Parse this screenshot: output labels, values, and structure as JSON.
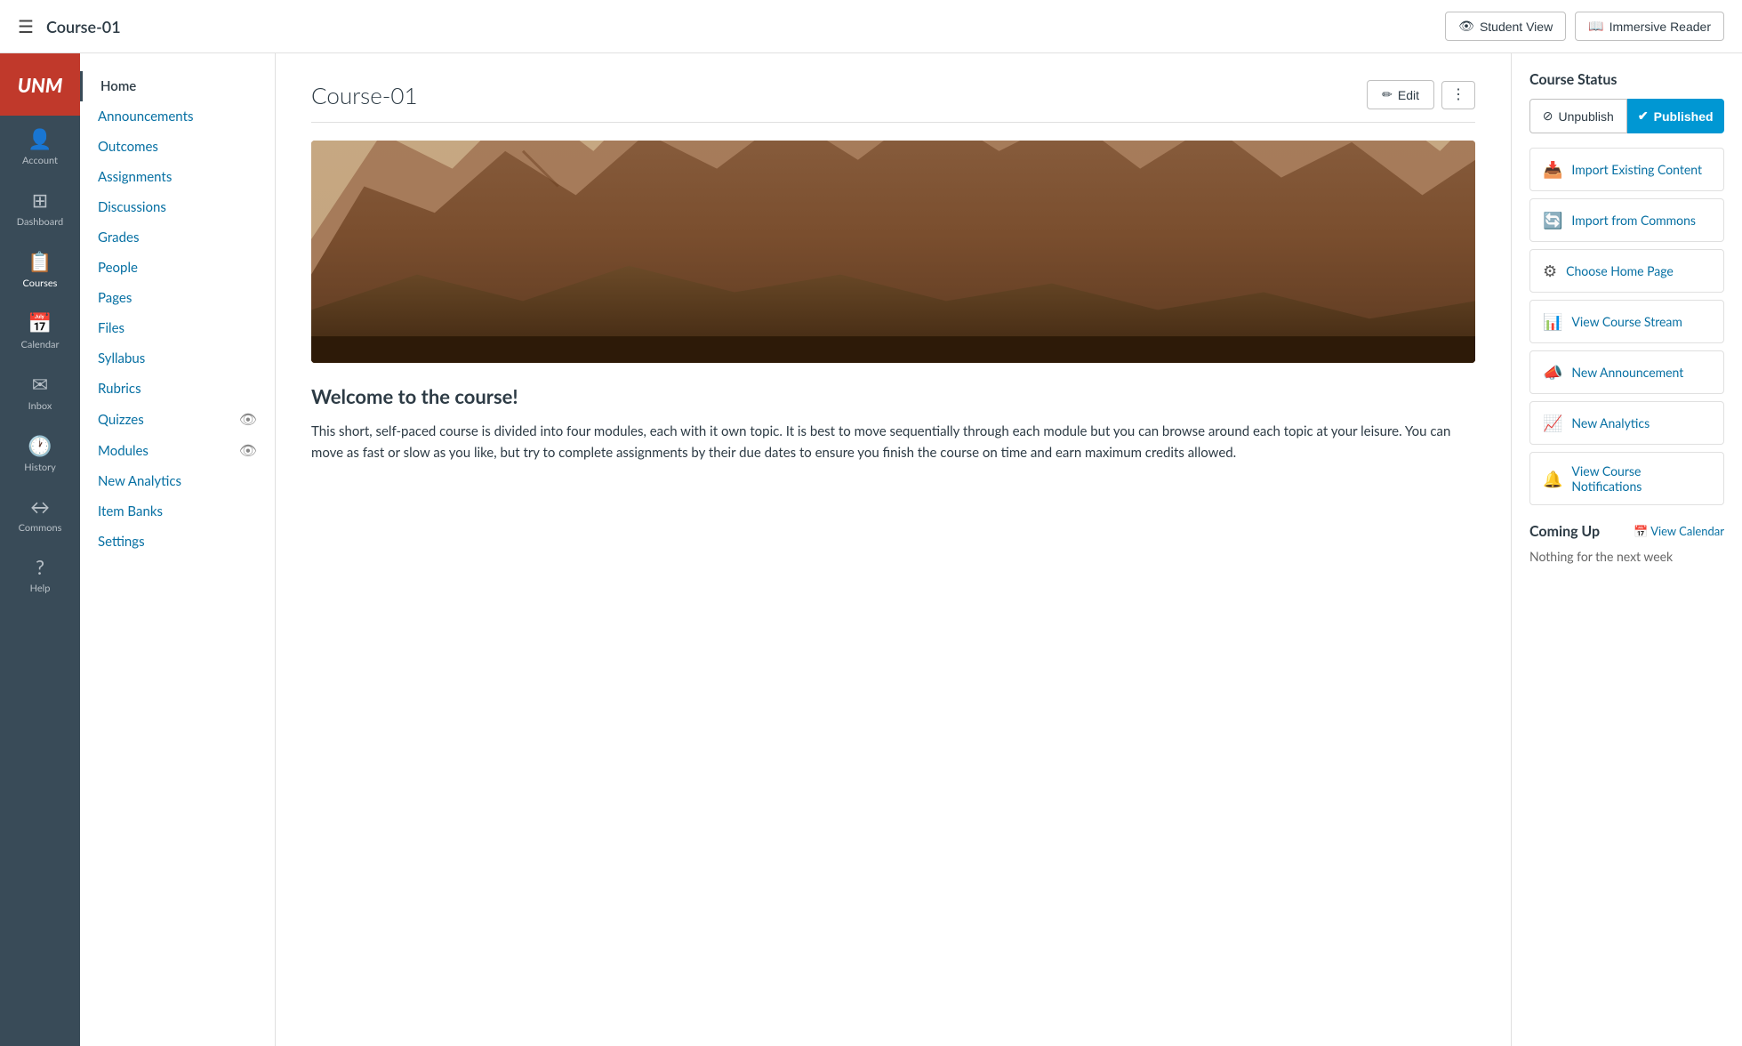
{
  "topbar": {
    "title": "Course-01",
    "hamburger_label": "☰",
    "student_view_label": "Student View",
    "immersive_reader_label": "Immersive Reader"
  },
  "global_nav": {
    "items": [
      {
        "id": "account",
        "label": "Account",
        "icon": "👤"
      },
      {
        "id": "dashboard",
        "label": "Dashboard",
        "icon": "⊞"
      },
      {
        "id": "courses",
        "label": "Courses",
        "icon": "📋"
      },
      {
        "id": "calendar",
        "label": "Calendar",
        "icon": "📅"
      },
      {
        "id": "inbox",
        "label": "Inbox",
        "icon": "✉"
      },
      {
        "id": "history",
        "label": "History",
        "icon": "🕐"
      },
      {
        "id": "commons",
        "label": "Commons",
        "icon": "↔"
      },
      {
        "id": "help",
        "label": "Help",
        "icon": "?"
      }
    ]
  },
  "course_nav": {
    "items": [
      {
        "id": "home",
        "label": "Home",
        "active": true
      },
      {
        "id": "announcements",
        "label": "Announcements"
      },
      {
        "id": "outcomes",
        "label": "Outcomes"
      },
      {
        "id": "assignments",
        "label": "Assignments"
      },
      {
        "id": "discussions",
        "label": "Discussions"
      },
      {
        "id": "grades",
        "label": "Grades"
      },
      {
        "id": "people",
        "label": "People"
      },
      {
        "id": "pages",
        "label": "Pages"
      },
      {
        "id": "files",
        "label": "Files"
      },
      {
        "id": "syllabus",
        "label": "Syllabus"
      },
      {
        "id": "rubrics",
        "label": "Rubrics"
      },
      {
        "id": "quizzes",
        "label": "Quizzes",
        "has_visibility": true
      },
      {
        "id": "modules",
        "label": "Modules",
        "has_visibility": true
      },
      {
        "id": "new-analytics",
        "label": "New Analytics"
      },
      {
        "id": "item-banks",
        "label": "Item Banks"
      },
      {
        "id": "settings",
        "label": "Settings"
      }
    ]
  },
  "main": {
    "course_title": "Course-01",
    "edit_label": "Edit",
    "welcome_title": "Welcome to the course!",
    "welcome_text": "This short, self-paced course is divided into four modules, each with it own topic. It is best to move sequentially through each module but you can browse around each topic at your leisure. You can move as fast or slow as you like, but try to complete assignments by their due dates to ensure you finish the course on time and earn maximum credits allowed."
  },
  "right_sidebar": {
    "course_status_title": "Course Status",
    "unpublish_label": "Unpublish",
    "published_label": "Published",
    "actions": [
      {
        "id": "import-existing",
        "label": "Import Existing Content",
        "icon": "📥"
      },
      {
        "id": "import-commons",
        "label": "Import from Commons",
        "icon": "🔄"
      },
      {
        "id": "choose-home",
        "label": "Choose Home Page",
        "icon": "⚙"
      },
      {
        "id": "view-stream",
        "label": "View Course Stream",
        "icon": "📊"
      },
      {
        "id": "new-announcement",
        "label": "New Announcement",
        "icon": "📣"
      },
      {
        "id": "new-analytics",
        "label": "New Analytics",
        "icon": "📈"
      },
      {
        "id": "view-notifications",
        "label": "View Course Notifications",
        "icon": "🔔"
      }
    ],
    "coming_up_title": "Coming Up",
    "view_calendar_label": "View Calendar",
    "coming_up_empty": "Nothing for the next week"
  }
}
